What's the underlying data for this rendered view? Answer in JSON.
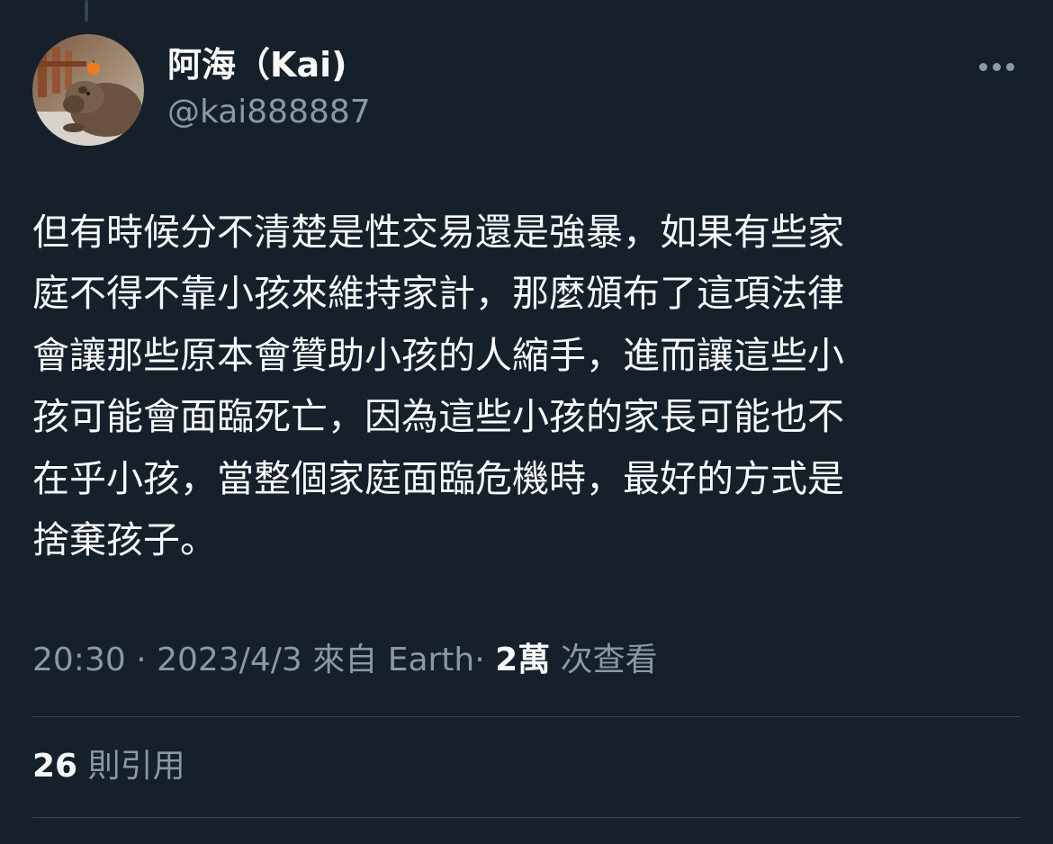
{
  "author": {
    "display_name": "阿海（Kai)",
    "handle": "@kai888887"
  },
  "tweet": {
    "text": "但有時候分不清楚是性交易還是強暴，如果有些家\n庭不得不靠小孩來維持家計，那麼頒布了這項法律\n會讓那些原本會贊助小孩的人縮手，進而讓這些小\n孩可能會面臨死亡，因為這些小孩的家長可能也不\n在乎小孩，當整個家庭面臨危機時，最好的方式是\n捨棄孩子。"
  },
  "meta": {
    "time": "20:30",
    "sep1": "·",
    "date": "2023/4/3",
    "source": "來自 Earth",
    "sep2": "·",
    "views_count": "2萬",
    "views_label": "次查看"
  },
  "stats": {
    "quotes_count": "26",
    "quotes_label": "則引用"
  },
  "icons": {
    "more": "more-horizontal-icon"
  },
  "colors": {
    "background": "#15202b",
    "primary_text": "#f7f9f9",
    "secondary_text": "#8b98a5",
    "divider": "#38444d"
  }
}
